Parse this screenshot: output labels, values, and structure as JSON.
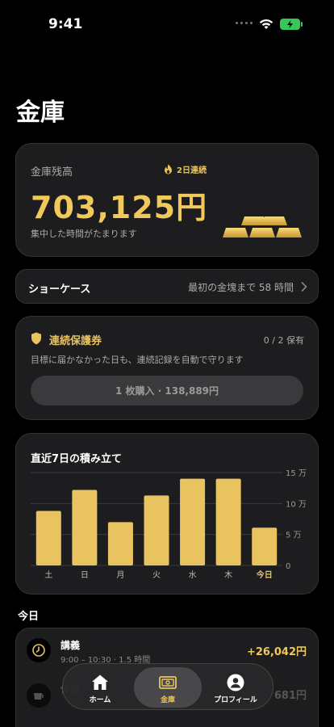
{
  "status_bar": {
    "time": "9:41"
  },
  "page_title": "金庫",
  "balance": {
    "label": "金庫残高",
    "streak": "2日連続",
    "amount": "703,125円",
    "subtitle": "集中した時間がたまります"
  },
  "showcase": {
    "label": "ショーケース",
    "info": "最初の金塊まで 58 時間"
  },
  "protection": {
    "title": "連続保護券",
    "count": "0 / 2 保有",
    "description": "目標に届かなかった日も、連続記録を自動で守ります",
    "button_label": "1 枚購入 · 138,889円"
  },
  "chart_data": {
    "type": "bar",
    "title": "直近7日の積み立て",
    "categories": [
      "土",
      "日",
      "月",
      "火",
      "水",
      "木",
      "今日"
    ],
    "values": [
      88000,
      122000,
      70000,
      113000,
      140000,
      140000,
      61000
    ],
    "ylim": [
      0,
      150000
    ],
    "yticks": [
      0,
      50000,
      100000,
      150000
    ],
    "ytick_labels": [
      "0",
      "5 万",
      "10 万",
      "15 万"
    ],
    "bar_color": "#e8c35f",
    "grid": true
  },
  "today": {
    "label": "今日",
    "sessions": [
      {
        "name": "講義",
        "time": "9:00 – 10:30 · 1.5 時間",
        "amount": "+26,042円"
      },
      {
        "name": "休憩",
        "amount": "681円"
      }
    ]
  },
  "tab_bar": {
    "tabs": [
      {
        "label": "ホーム",
        "icon": "home-icon"
      },
      {
        "label": "金庫",
        "icon": "vault-icon"
      },
      {
        "label": "プロフィール",
        "icon": "profile-icon"
      }
    ],
    "active_index": 1
  },
  "colors": {
    "accent": "#e8c35f",
    "background": "#000000",
    "card": "#1d1d1f"
  }
}
